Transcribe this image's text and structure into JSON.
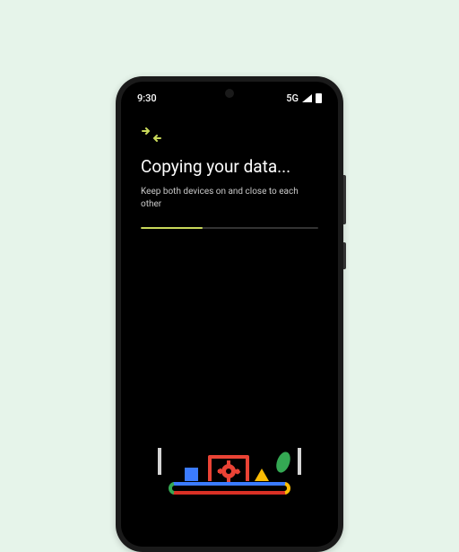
{
  "status_bar": {
    "time": "9:30",
    "network": "5G"
  },
  "screen": {
    "title": "Copying your data...",
    "subtitle": "Keep both devices on and close to each other",
    "progress_percent": 35
  },
  "colors": {
    "accent": "#c9d95a",
    "background": "#000000",
    "page_bg": "#e6f4ea"
  },
  "illustration": {
    "description": "conveyor-belt-with-shapes",
    "shapes": [
      "blue-square",
      "red-gear",
      "yellow-triangle",
      "green-oval"
    ]
  }
}
